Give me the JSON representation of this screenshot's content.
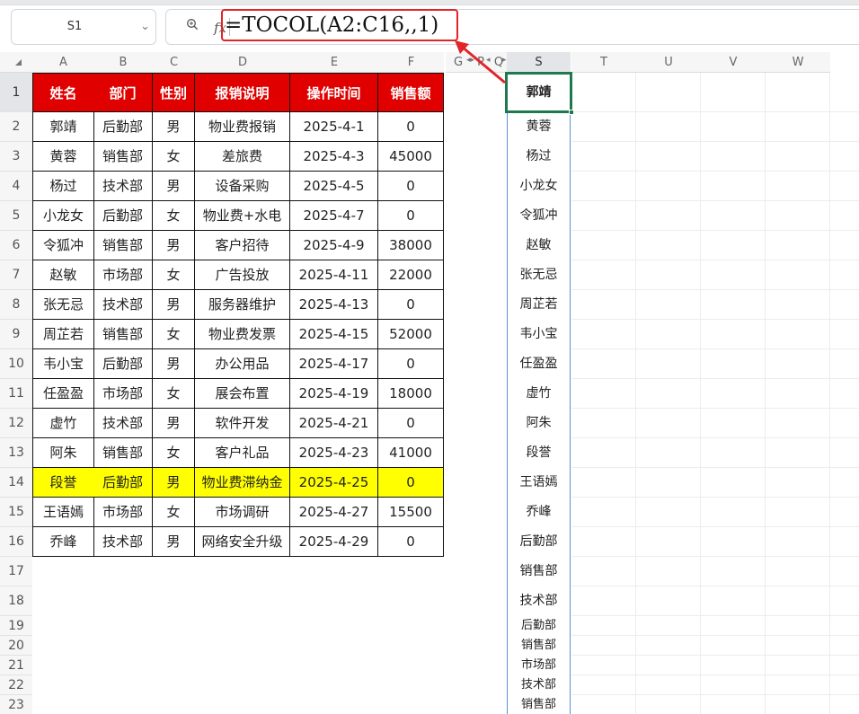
{
  "toolbar": {
    "name_box": "S1",
    "name_box_arrow_icon": "chevron-down-icon",
    "zoom_icon": "zoom-icon",
    "fx_label": "fx",
    "formula": "=TOCOL(A2:C16,,1)"
  },
  "colors": {
    "header_fill": "#e00000",
    "highlight_fill": "#ffff00",
    "annotation_red": "#e2242a",
    "active_cell_border": "#1e7a4e"
  },
  "columns": [
    "A",
    "B",
    "C",
    "D",
    "E",
    "F",
    "G",
    "P",
    "Q",
    "S",
    "T",
    "U",
    "V",
    "W"
  ],
  "rows": [
    "1",
    "2",
    "3",
    "4",
    "5",
    "6",
    "7",
    "8",
    "9",
    "10",
    "11",
    "12",
    "13",
    "14",
    "15",
    "16",
    "17",
    "18",
    "19",
    "20",
    "21",
    "22",
    "23"
  ],
  "table": {
    "headers": [
      "姓名",
      "部门",
      "性别",
      "报销说明",
      "操作时间",
      "销售额"
    ],
    "rows": [
      [
        "郭靖",
        "后勤部",
        "男",
        "物业费报销",
        "2025-4-1",
        "0"
      ],
      [
        "黄蓉",
        "销售部",
        "女",
        "差旅费",
        "2025-4-3",
        "45000"
      ],
      [
        "杨过",
        "技术部",
        "男",
        "设备采购",
        "2025-4-5",
        "0"
      ],
      [
        "小龙女",
        "后勤部",
        "女",
        "物业费+水电",
        "2025-4-7",
        "0"
      ],
      [
        "令狐冲",
        "销售部",
        "男",
        "客户招待",
        "2025-4-9",
        "38000"
      ],
      [
        "赵敏",
        "市场部",
        "女",
        "广告投放",
        "2025-4-11",
        "22000"
      ],
      [
        "张无忌",
        "技术部",
        "男",
        "服务器维护",
        "2025-4-13",
        "0"
      ],
      [
        "周芷若",
        "销售部",
        "女",
        "物业费发票",
        "2025-4-15",
        "52000"
      ],
      [
        "韦小宝",
        "后勤部",
        "男",
        "办公用品",
        "2025-4-17",
        "0"
      ],
      [
        "任盈盈",
        "市场部",
        "女",
        "展会布置",
        "2025-4-19",
        "18000"
      ],
      [
        "虚竹",
        "技术部",
        "男",
        "软件开发",
        "2025-4-21",
        "0"
      ],
      [
        "阿朱",
        "销售部",
        "女",
        "客户礼品",
        "2025-4-23",
        "41000"
      ],
      [
        "段誉",
        "后勤部",
        "男",
        "物业费滞纳金",
        "2025-4-25",
        "0"
      ],
      [
        "王语嫣",
        "市场部",
        "女",
        "市场调研",
        "2025-4-27",
        "15500"
      ],
      [
        "乔峰",
        "技术部",
        "男",
        "网络安全升级",
        "2025-4-29",
        "0"
      ]
    ],
    "highlighted_row_index": 12
  },
  "column_s": [
    "郭靖",
    "黄蓉",
    "杨过",
    "小龙女",
    "令狐冲",
    "赵敏",
    "张无忌",
    "周芷若",
    "韦小宝",
    "任盈盈",
    "虚竹",
    "阿朱",
    "段誉",
    "王语嫣",
    "乔峰",
    "后勤部",
    "销售部",
    "技术部",
    "后勤部",
    "销售部",
    "市场部",
    "技术部",
    "销售部"
  ]
}
